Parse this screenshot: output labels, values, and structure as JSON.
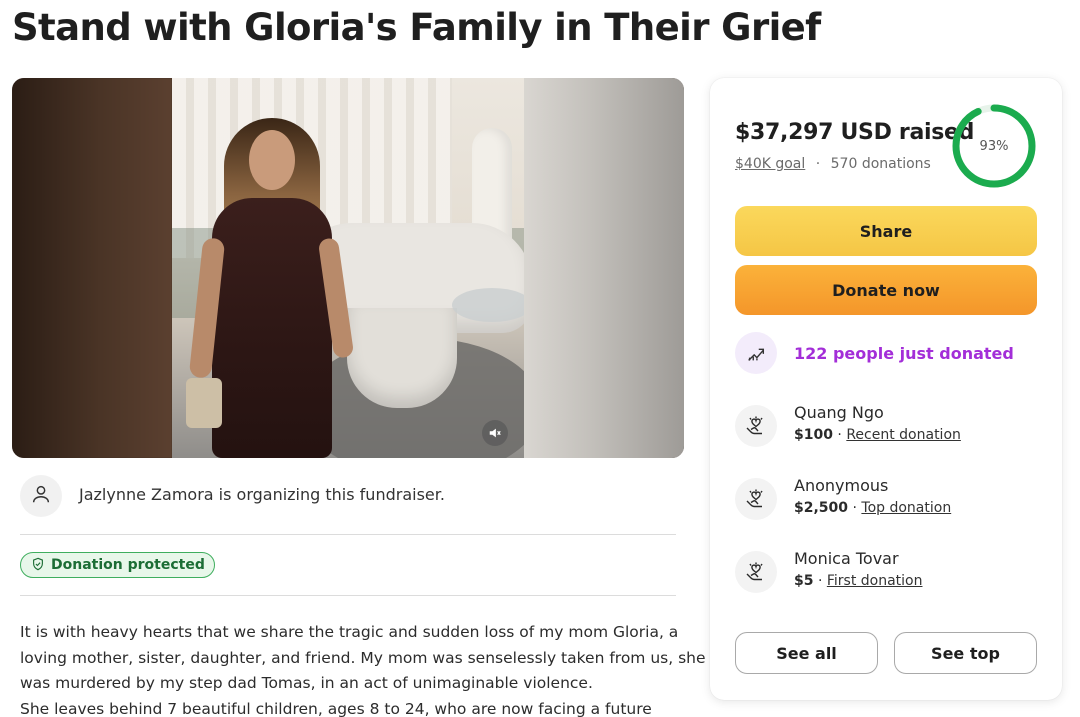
{
  "page": {
    "title": "Stand with Gloria's Family in Their Grief"
  },
  "colors": {
    "accent_green": "#1bab4e",
    "share_yellow": "#f7cd4f",
    "donate_orange": "#f6a230",
    "trend_purple": "#a32ed8"
  },
  "media": {
    "icon": "speaker-muted-icon"
  },
  "organizer": {
    "icon": "user-icon",
    "text": "Jazlynne Zamora is organizing this fundraiser."
  },
  "badge": {
    "icon": "shield-check-icon",
    "label": "Donation protected"
  },
  "story": {
    "lines": [
      "It is with heavy hearts that we share the tragic and sudden loss of my mom Gloria, a",
      "loving mother, sister, daughter, and friend. My mom was senselessly taken from us, she",
      "was murdered by my step dad Tomas, in an act of unimaginable violence.",
      "She leaves behind 7 beautiful children, ages 8 to 24, who are now facing a future"
    ]
  },
  "summary": {
    "raised": "$37,297 USD raised",
    "goal": "$40K goal",
    "separator": "·",
    "donations": "570 donations",
    "percent_label": "93%",
    "progress": 0.93
  },
  "actions": {
    "share": "Share",
    "donate": "Donate now",
    "see_all": "See all",
    "see_top": "See top"
  },
  "activity": {
    "icon": "trending-up-icon",
    "text": "122 people just donated"
  },
  "donors": [
    {
      "name": "Quang Ngo",
      "amount": "$100",
      "sep": "·",
      "tag": "Recent donation",
      "icon": "heart-hand-icon"
    },
    {
      "name": "Anonymous",
      "amount": "$2,500",
      "sep": "·",
      "tag": "Top donation",
      "icon": "heart-hand-icon"
    },
    {
      "name": "Monica Tovar",
      "amount": "$5",
      "sep": "·",
      "tag": "First donation",
      "icon": "heart-hand-icon"
    }
  ]
}
